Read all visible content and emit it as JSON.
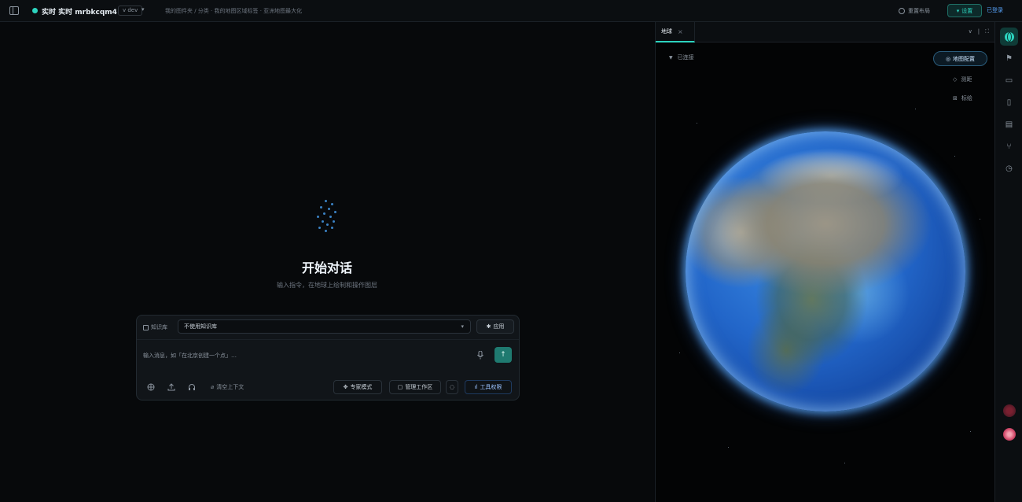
{
  "topbar": {
    "title": "实时 实时 mrbkcqm4",
    "badge": "v dev",
    "breadcrumb": "我的图件夹 / 分类 · 我的地图区域标签 · 亚洲地图最大化",
    "layout_label": "重置布局",
    "settings_label": "设置",
    "extra_label": "已登录"
  },
  "chat": {
    "title": "开始对话",
    "subtitle": "输入指令，在地球上绘制和操作图层",
    "kb_label": "知识库",
    "kb_selected": "不使用知识库",
    "apply_label": "应用",
    "input_placeholder": "输入消息，如「在北京创建一个点」…",
    "context_label": "清空上下文",
    "expert_label": "专家模式",
    "workspace_label": "管理工作区",
    "tools_label": "工具权限"
  },
  "map": {
    "tab_label": "地球",
    "connected_label": "已连接",
    "layer_btn_label": "地图配置",
    "opt1_label": "测距",
    "opt2_label": "标绘"
  },
  "icons": {
    "sidebar_toggle": "sidebar-toggle-icon",
    "settings": "gear-icon",
    "mic": "microphone-icon",
    "send": "arrow-up-icon",
    "globe": "globe-icon"
  },
  "colors": {
    "accent": "#2dd4bf",
    "background": "#06080a",
    "panel": "#111519"
  }
}
